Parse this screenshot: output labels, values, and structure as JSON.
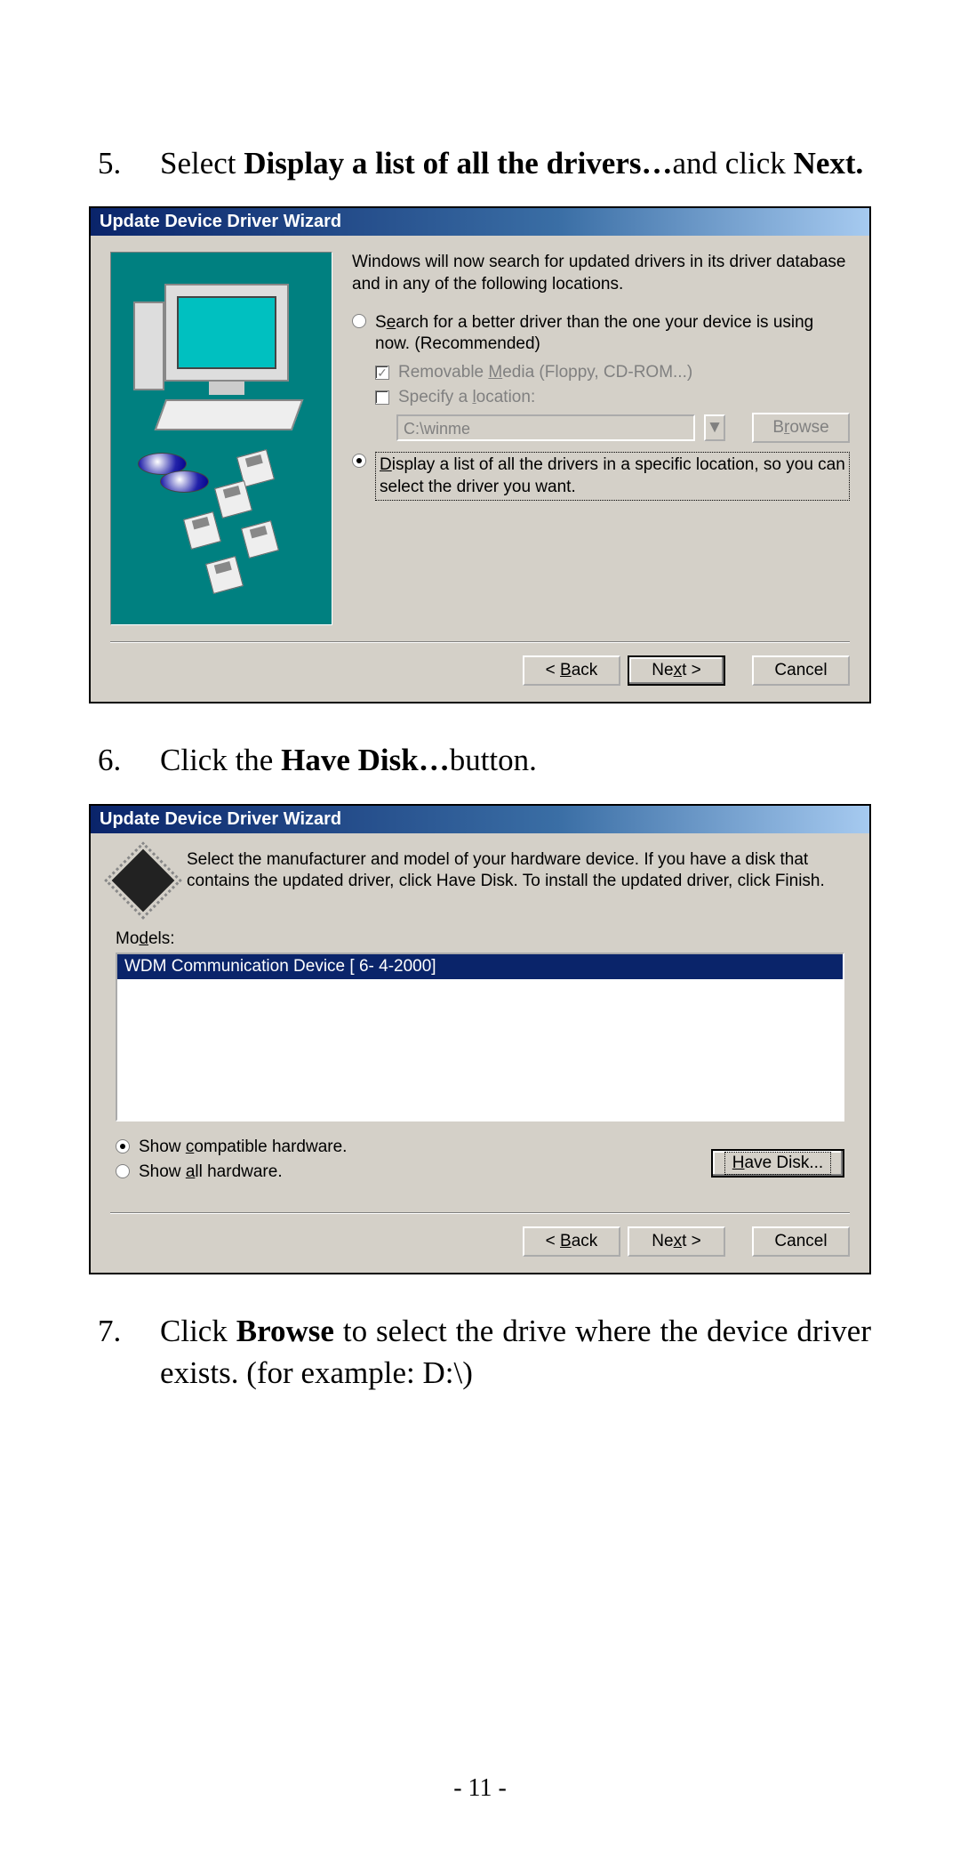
{
  "steps": {
    "s5": {
      "num": "5.",
      "t1": "Select ",
      "b1": "Display a list of all the drivers…",
      "t2": "and click ",
      "b2": "Next."
    },
    "s6": {
      "num": "6.",
      "t1": "Click the ",
      "b1": "Have Disk…",
      "t2": "button."
    },
    "s7": {
      "num": "7.",
      "t1": "Click ",
      "b1": "Browse",
      "t2": " to select the drive where the device driver exists.  (for example: D:\\)"
    }
  },
  "wiz1": {
    "title": "Update Device Driver Wizard",
    "desc": "Windows will now search for updated drivers in its driver database and in any of the following locations.",
    "opt1_pre": "S",
    "opt1_u": "e",
    "opt1_post": "arch for a better driver than the one your device is using now. (Recommended)",
    "chk1_pre": "Removable ",
    "chk1_u": "M",
    "chk1_post": "edia (Floppy, CD-ROM...)",
    "chk2_pre": "Specify a ",
    "chk2_u": "l",
    "chk2_post": "ocation:",
    "path": "C:\\winme",
    "browse_u": "r",
    "browse_pre": "B",
    "browse_post": "owse",
    "opt2_u": "D",
    "opt2_post": "isplay a list of all the drivers in a specific location, so you can select the driver you want.",
    "back_pre": "< ",
    "back_u": "B",
    "back_post": "ack",
    "next_pre": "Ne",
    "next_u": "x",
    "next_post": "t >",
    "cancel": "Cancel"
  },
  "wiz2": {
    "title": "Update Device Driver Wizard",
    "desc": "Select the manufacturer and model of your hardware device. If you have a disk that contains the updated driver, click Have Disk. To install the updated driver, click Finish.",
    "models_pre": "Mo",
    "models_u": "d",
    "models_post": "els:",
    "item": "WDM Communication Device [ 6- 4-2000]",
    "show_comp_pre": "Show ",
    "show_comp_u": "c",
    "show_comp_post": "ompatible hardware.",
    "show_all_pre": "Show ",
    "show_all_u": "a",
    "show_all_post": "ll hardware.",
    "have_u": "H",
    "have_post": "ave Disk...",
    "back_pre": "< ",
    "back_u": "B",
    "back_post": "ack",
    "next_pre": "Ne",
    "next_u": "x",
    "next_post": "t >",
    "cancel": "Cancel"
  },
  "page": "- 11 -"
}
